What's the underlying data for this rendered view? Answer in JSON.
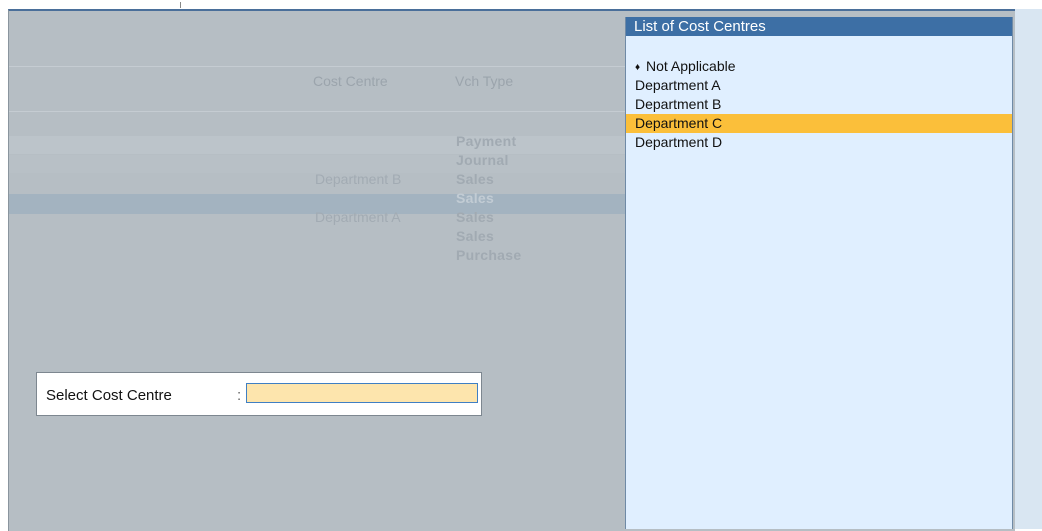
{
  "report": {
    "col_cost_centre": "Cost Centre",
    "col_vch_type": "Vch Type",
    "rows": [
      {
        "cost_centre": "",
        "vch_type": "Payment"
      },
      {
        "cost_centre": "",
        "vch_type": "Journal"
      },
      {
        "cost_centre": "Department B",
        "vch_type": "Sales"
      },
      {
        "cost_centre": "",
        "vch_type": "Sales"
      },
      {
        "cost_centre": "Department A",
        "vch_type": "Sales"
      },
      {
        "cost_centre": "",
        "vch_type": "Sales"
      },
      {
        "cost_centre": "",
        "vch_type": "Purchase"
      }
    ]
  },
  "dialog": {
    "label": "Select Cost Centre",
    "colon": ":",
    "input_value": ""
  },
  "cost_centre_list": {
    "title": "List of Cost Centres",
    "items": [
      {
        "label": "Not Applicable",
        "bullet": "♦"
      },
      {
        "label": "Department A"
      },
      {
        "label": "Department B"
      },
      {
        "label": "Department C"
      },
      {
        "label": "Department D"
      }
    ],
    "selected_index": 3
  },
  "colors": {
    "highlight": "#fbbf3a",
    "list_title_bg": "#3d6fa5",
    "input_bg": "#fde5ad"
  }
}
